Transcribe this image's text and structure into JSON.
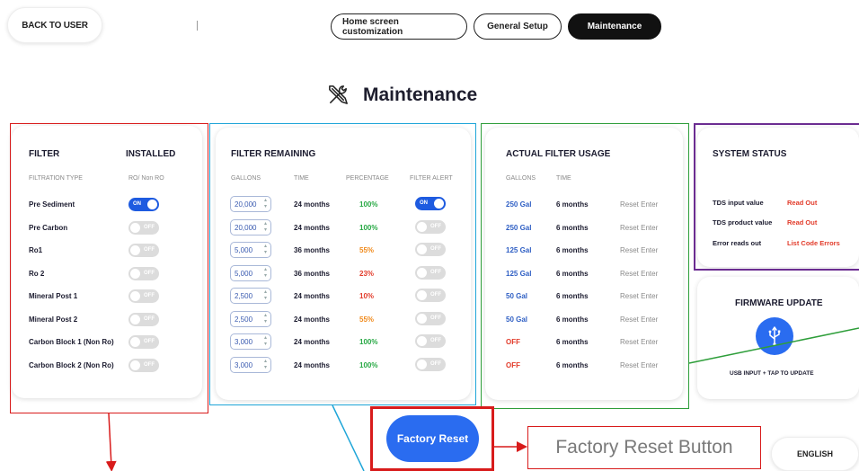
{
  "top": {
    "back_label": "BACK TO USER",
    "tabs": [
      "Home screen customization",
      "General Setup",
      "Maintenance"
    ],
    "active_tab": "Maintenance"
  },
  "page_title": "Maintenance",
  "filter_card": {
    "col_filter": "FILTER",
    "col_installed": "INSTALLED",
    "sub_type": "FILTRATION TYPE",
    "sub_ro": "RO/ Non RO",
    "rows": [
      {
        "name": "Pre Sediment",
        "installed": "ON"
      },
      {
        "name": "Pre Carbon",
        "installed": "OFF"
      },
      {
        "name": "Ro1",
        "installed": "OFF"
      },
      {
        "name": "Ro 2",
        "installed": "OFF"
      },
      {
        "name": "Mineral Post 1",
        "installed": "OFF"
      },
      {
        "name": "Mineral Post 2",
        "installed": "OFF"
      },
      {
        "name": "Carbon Block 1 (Non Ro)",
        "installed": "OFF"
      },
      {
        "name": "Carbon Block 2 (Non Ro)",
        "installed": "OFF"
      }
    ]
  },
  "remaining_card": {
    "title": "FILTER REMAINING",
    "headers": [
      "GALLONS",
      "TIME",
      "PERCENTAGE",
      "FILTER ALERT"
    ],
    "rows": [
      {
        "gallons": "20,000",
        "time": "24 months",
        "percentage": "100%",
        "pct_color": "#27a844",
        "alert": "ON"
      },
      {
        "gallons": "20,000",
        "time": "24 months",
        "percentage": "100%",
        "pct_color": "#27a844",
        "alert": "OFF"
      },
      {
        "gallons": "5,000",
        "time": "36 months",
        "percentage": "55%",
        "pct_color": "#f08a1c",
        "alert": "OFF"
      },
      {
        "gallons": "5,000",
        "time": "36 months",
        "percentage": "23%",
        "pct_color": "#e23b2a",
        "alert": "OFF"
      },
      {
        "gallons": "2,500",
        "time": "24 months",
        "percentage": "10%",
        "pct_color": "#e23b2a",
        "alert": "OFF"
      },
      {
        "gallons": "2,500",
        "time": "24 months",
        "percentage": "55%",
        "pct_color": "#f08a1c",
        "alert": "OFF"
      },
      {
        "gallons": "3,000",
        "time": "24 months",
        "percentage": "100%",
        "pct_color": "#27a844",
        "alert": "OFF"
      },
      {
        "gallons": "3,000",
        "time": "24 months",
        "percentage": "100%",
        "pct_color": "#27a844",
        "alert": "OFF"
      }
    ]
  },
  "usage_card": {
    "title": "ACTUAL FILTER USAGE",
    "headers": [
      "GALLONS",
      "TIME"
    ],
    "rows": [
      {
        "gallons": "250 Gal",
        "g_color": "#2f5fc4",
        "time": "6 months",
        "action": "Reset Enter"
      },
      {
        "gallons": "250 Gal",
        "g_color": "#2f5fc4",
        "time": "6 months",
        "action": "Reset Enter"
      },
      {
        "gallons": "125 Gal",
        "g_color": "#2f5fc4",
        "time": "6 months",
        "action": "Reset Enter"
      },
      {
        "gallons": "125 Gal",
        "g_color": "#2f5fc4",
        "time": "6 months",
        "action": "Reset Enter"
      },
      {
        "gallons": "50 Gal",
        "g_color": "#2f5fc4",
        "time": "6 months",
        "action": "Reset Enter"
      },
      {
        "gallons": "50 Gal",
        "g_color": "#2f5fc4",
        "time": "6 months",
        "action": "Reset Enter"
      },
      {
        "gallons": "OFF",
        "g_color": "#e23b2a",
        "time": "6 months",
        "action": "Reset Enter"
      },
      {
        "gallons": "OFF",
        "g_color": "#e23b2a",
        "time": "6 months",
        "action": "Reset Enter"
      }
    ]
  },
  "status_card": {
    "title": "SYSTEM STATUS",
    "rows": [
      {
        "label": "TDS input value",
        "value": "Read Out"
      },
      {
        "label": "TDS product value",
        "value": "Read Out"
      },
      {
        "label": "Error reads out",
        "value": "List Code Errors"
      }
    ]
  },
  "firmware_card": {
    "title": "FIRMWARE UPDATE",
    "caption": "USB INPUT + TAP TO UPDATE",
    "icon": "usb-icon"
  },
  "factory_reset_label": "Factory Reset",
  "callout_label": "Factory Reset Button",
  "language_label": "ENGLISH",
  "colors": {
    "accent": "#2a6cf0",
    "annotation_red": "#d81b1b",
    "annotation_blue": "#1ea5d8",
    "annotation_green": "#2e9e3a",
    "annotation_purple": "#6b2c91"
  }
}
